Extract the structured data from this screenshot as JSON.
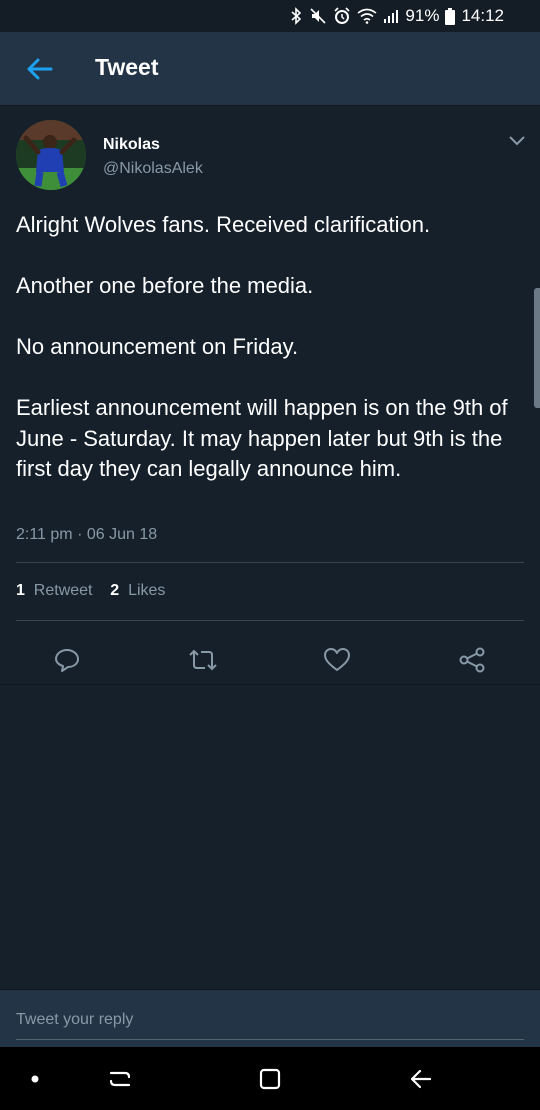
{
  "status_bar": {
    "battery": "91%",
    "time": "14:12"
  },
  "app_bar": {
    "title": "Tweet"
  },
  "tweet": {
    "author_name": "Nikolas",
    "author_handle": "@NikolasAlek",
    "paragraphs": [
      "Alright Wolves fans. Received clarification.",
      "Another one before the media.",
      "No announcement on Friday.",
      "Earliest announcement will happen is on the 9th of June - Saturday. It may happen later but 9th is the first day they can legally announce him."
    ],
    "timestamp": "2:11 pm · 06 Jun 18",
    "retweets_count": "1",
    "retweets_label": "Retweet",
    "likes_count": "2",
    "likes_label": "Likes"
  },
  "actions": [
    "reply-icon",
    "retweet-icon",
    "like-icon",
    "share-icon"
  ],
  "reply": {
    "placeholder": "Tweet your reply"
  },
  "colors": {
    "background": "#15202b",
    "header": "#243447",
    "accent": "#1da1f2",
    "secondary_text": "#8899a6"
  }
}
